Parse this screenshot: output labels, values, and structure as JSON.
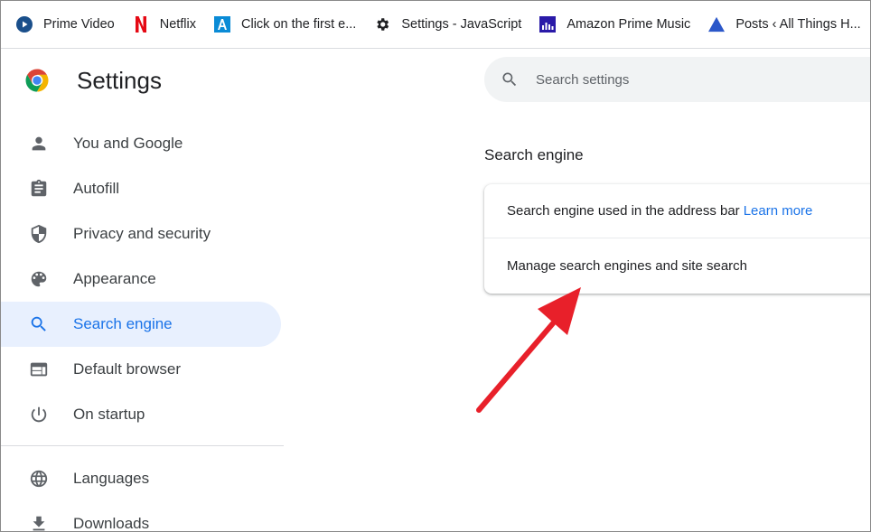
{
  "bookmarks": [
    {
      "label": "Prime Video",
      "icon": "prime-video-icon"
    },
    {
      "label": "Netflix",
      "icon": "netflix-icon"
    },
    {
      "label": "Click on the first e...",
      "icon": "azure-icon"
    },
    {
      "label": "Settings - JavaScript",
      "icon": "gear-icon"
    },
    {
      "label": "Amazon Prime Music",
      "icon": "music-icon"
    },
    {
      "label": "Posts ‹ All Things H...",
      "icon": "triangle-icon"
    }
  ],
  "header": {
    "title": "Settings",
    "logo": "chrome-logo"
  },
  "search": {
    "placeholder": "Search settings"
  },
  "sidebar": {
    "items": [
      {
        "label": "You and Google",
        "icon": "person-icon"
      },
      {
        "label": "Autofill",
        "icon": "clipboard-icon"
      },
      {
        "label": "Privacy and security",
        "icon": "shield-icon"
      },
      {
        "label": "Appearance",
        "icon": "palette-icon"
      },
      {
        "label": "Search engine",
        "icon": "search-icon",
        "active": true
      },
      {
        "label": "Default browser",
        "icon": "browser-icon"
      },
      {
        "label": "On startup",
        "icon": "power-icon"
      },
      {
        "label": "Languages",
        "icon": "globe-icon"
      },
      {
        "label": "Downloads",
        "icon": "download-icon"
      }
    ]
  },
  "main": {
    "section_title": "Search engine",
    "rows": {
      "address_bar": "Search engine used in the address bar",
      "learn_more": "Learn more",
      "manage": "Manage search engines and site search"
    }
  },
  "colors": {
    "accent": "#1a73e8",
    "active_bg": "#e8f0fe",
    "annotation_arrow": "#e8202a"
  }
}
